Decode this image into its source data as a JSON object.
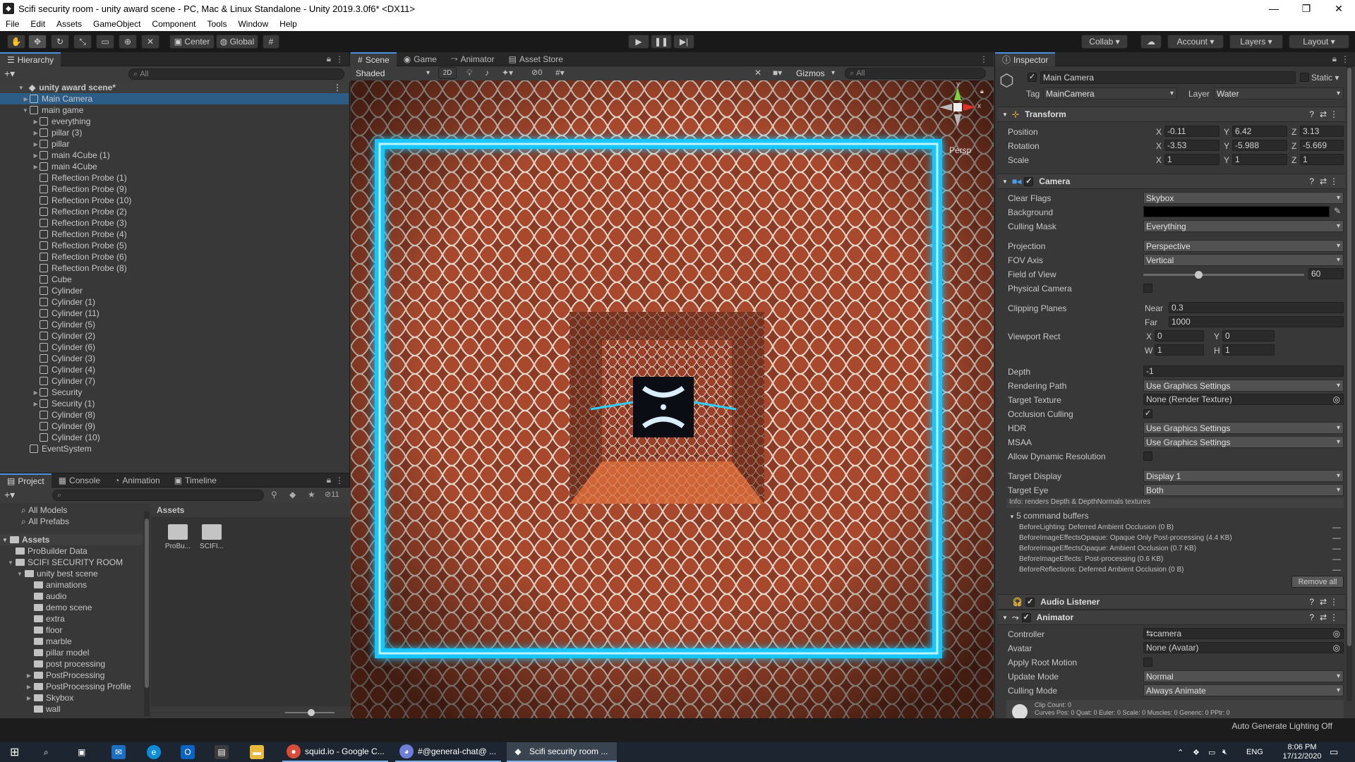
{
  "window": {
    "title": "Scifi security room - unity award scene - PC, Mac & Linux Standalone - Unity 2019.3.0f6* <DX11>",
    "controls": [
      "—",
      "❐",
      "✕"
    ]
  },
  "menu": [
    "File",
    "Edit",
    "Assets",
    "GameObject",
    "Component",
    "Tools",
    "Window",
    "Help"
  ],
  "toolbar": {
    "pivot": "Center",
    "space": "Global",
    "collab": "Collab ▾",
    "account": "Account",
    "layers": "Layers",
    "layout": "Layout"
  },
  "hierarchy": {
    "tab": "Hierarchy",
    "search_placeholder": "All",
    "scene": "unity award scene*",
    "items": [
      {
        "label": "Main Camera",
        "indent": 1,
        "arrow": "▶"
      },
      {
        "label": "main game",
        "indent": 1,
        "arrow": "▼"
      },
      {
        "label": "everything",
        "indent": 2,
        "arrow": "▶"
      },
      {
        "label": "pillar (3)",
        "indent": 2,
        "arrow": "▶"
      },
      {
        "label": "pillar",
        "indent": 2,
        "arrow": "▶"
      },
      {
        "label": "main 4Cube (1)",
        "indent": 2,
        "arrow": "▶"
      },
      {
        "label": "main 4Cube",
        "indent": 2,
        "arrow": "▶"
      },
      {
        "label": "Reflection Probe (1)",
        "indent": 2,
        "arrow": ""
      },
      {
        "label": "Reflection Probe (9)",
        "indent": 2,
        "arrow": ""
      },
      {
        "label": "Reflection Probe (10)",
        "indent": 2,
        "arrow": ""
      },
      {
        "label": "Reflection Probe (2)",
        "indent": 2,
        "arrow": ""
      },
      {
        "label": "Reflection Probe (3)",
        "indent": 2,
        "arrow": ""
      },
      {
        "label": "Reflection Probe (4)",
        "indent": 2,
        "arrow": ""
      },
      {
        "label": "Reflection Probe (5)",
        "indent": 2,
        "arrow": ""
      },
      {
        "label": "Reflection Probe (6)",
        "indent": 2,
        "arrow": ""
      },
      {
        "label": "Reflection Probe (8)",
        "indent": 2,
        "arrow": ""
      },
      {
        "label": "Cube",
        "indent": 2,
        "arrow": ""
      },
      {
        "label": "Cylinder",
        "indent": 2,
        "arrow": ""
      },
      {
        "label": "Cylinder (1)",
        "indent": 2,
        "arrow": ""
      },
      {
        "label": "Cylinder (11)",
        "indent": 2,
        "arrow": ""
      },
      {
        "label": "Cylinder (5)",
        "indent": 2,
        "arrow": ""
      },
      {
        "label": "Cylinder (2)",
        "indent": 2,
        "arrow": ""
      },
      {
        "label": "Cylinder (6)",
        "indent": 2,
        "arrow": ""
      },
      {
        "label": "Cylinder (3)",
        "indent": 2,
        "arrow": ""
      },
      {
        "label": "Cylinder (4)",
        "indent": 2,
        "arrow": ""
      },
      {
        "label": "Cylinder (7)",
        "indent": 2,
        "arrow": ""
      },
      {
        "label": "Security",
        "indent": 2,
        "arrow": "▶"
      },
      {
        "label": "Security (1)",
        "indent": 2,
        "arrow": "▶"
      },
      {
        "label": "Cylinder (8)",
        "indent": 2,
        "arrow": ""
      },
      {
        "label": "Cylinder (9)",
        "indent": 2,
        "arrow": ""
      },
      {
        "label": "Cylinder (10)",
        "indent": 2,
        "arrow": ""
      },
      {
        "label": "EventSystem",
        "indent": 1,
        "arrow": ""
      }
    ]
  },
  "bottom_tabs": [
    "Project",
    "Console",
    "Animation",
    "Timeline"
  ],
  "project": {
    "favorites": [
      "All Models",
      "All Prefabs"
    ],
    "assets_label": "Assets",
    "tree": [
      {
        "label": "ProBuilder Data",
        "indent": 1,
        "arrow": ""
      },
      {
        "label": "SCIFI SECURITY ROOM",
        "indent": 1,
        "arrow": "▼"
      },
      {
        "label": "unity best scene",
        "indent": 2,
        "arrow": "▼"
      },
      {
        "label": "animations",
        "indent": 3,
        "arrow": ""
      },
      {
        "label": "audio",
        "indent": 3,
        "arrow": ""
      },
      {
        "label": "demo scene",
        "indent": 3,
        "arrow": ""
      },
      {
        "label": "extra",
        "indent": 3,
        "arrow": ""
      },
      {
        "label": "floor",
        "indent": 3,
        "arrow": ""
      },
      {
        "label": "marble",
        "indent": 3,
        "arrow": ""
      },
      {
        "label": "pillar model",
        "indent": 3,
        "arrow": ""
      },
      {
        "label": "post processing",
        "indent": 3,
        "arrow": ""
      },
      {
        "label": "PostProcessing",
        "indent": 3,
        "arrow": "▶"
      },
      {
        "label": "PostProcessing Profile",
        "indent": 3,
        "arrow": "▶"
      },
      {
        "label": "Skybox",
        "indent": 3,
        "arrow": "▶"
      },
      {
        "label": "wall",
        "indent": 3,
        "arrow": ""
      }
    ],
    "grid_header": "Assets",
    "grid_items": [
      "ProBu...",
      "SCIFI..."
    ],
    "hidden_count": "11"
  },
  "scene_view": {
    "tabs": [
      "Scene",
      "Game",
      "Animator",
      "Asset Store"
    ],
    "shading": "Shaded",
    "mode_2d": "2D",
    "hidden_count": "0",
    "gizmos": "Gizmos",
    "search_placeholder": "All",
    "persp": "Persp",
    "axis_x": "x",
    "axis_y": "y"
  },
  "inspector": {
    "tab": "Inspector",
    "object_name": "Main Camera",
    "static": "Static",
    "tag_label": "Tag",
    "tag": "MainCamera",
    "layer_label": "Layer",
    "layer": "Water",
    "transform": {
      "title": "Transform",
      "rows": [
        {
          "label": "Position",
          "x": "-0.11",
          "y": "6.42",
          "z": "3.13"
        },
        {
          "label": "Rotation",
          "x": "-3.53",
          "y": "-5.988",
          "z": "-5.669"
        },
        {
          "label": "Scale",
          "x": "1",
          "y": "1",
          "z": "1"
        }
      ]
    },
    "camera": {
      "title": "Camera",
      "clear_flags_label": "Clear Flags",
      "clear_flags": "Skybox",
      "background_label": "Background",
      "culling_mask_label": "Culling Mask",
      "culling_mask": "Everything",
      "projection_label": "Projection",
      "projection": "Perspective",
      "fov_axis_label": "FOV Axis",
      "fov_axis": "Vertical",
      "fov_label": "Field of View",
      "fov": "60",
      "fov_slider_fraction": 0.34,
      "physical_label": "Physical Camera",
      "clipping_label": "Clipping Planes",
      "near_label": "Near",
      "near": "0.3",
      "far_label": "Far",
      "far": "1000",
      "viewport_label": "Viewport Rect",
      "vx": "0",
      "vy": "0",
      "vw": "1",
      "vh": "1",
      "depth_label": "Depth",
      "depth": "-1",
      "rendering_path_label": "Rendering Path",
      "rendering_path": "Use Graphics Settings",
      "target_texture_label": "Target Texture",
      "target_texture": "None (Render Texture)",
      "occlusion_label": "Occlusion Culling",
      "hdr_label": "HDR",
      "hdr": "Use Graphics Settings",
      "msaa_label": "MSAA",
      "msaa": "Use Graphics Settings",
      "dyn_res_label": "Allow Dynamic Resolution",
      "target_display_label": "Target Display",
      "target_display": "Display 1",
      "target_eye_label": "Target Eye",
      "target_eye": "Both",
      "info": "Info: renders Depth & DepthNormals textures",
      "cmd_header": "5 command buffers",
      "cmd_buffers": [
        "BeforeLighting: Deferred Ambient Occlusion (0 B)",
        "BeforeImageEffectsOpaque: Opaque Only Post-processing (4.4 KB)",
        "BeforeImageEffectsOpaque: Ambient Occlusion (0.7 KB)",
        "BeforeImageEffects: Post-processing (0.6 KB)",
        "BeforeReflections: Deferred Ambient Occlusion (0 B)"
      ],
      "remove_all": "Remove all"
    },
    "audio_listener": "Audio Listener",
    "animator": {
      "title": "Animator",
      "controller_label": "Controller",
      "controller": "camera",
      "avatar_label": "Avatar",
      "avatar": "None (Avatar)",
      "root_motion_label": "Apply Root Motion",
      "update_mode_label": "Update Mode",
      "update_mode": "Normal",
      "culling_mode_label": "Culling Mode",
      "culling_mode": "Always Animate",
      "clip_count": "Clip Count: 0",
      "curves": "Curves Pos: 0 Quat: 0 Euler: 0 Scale: 0 Muscles: 0 Generic: 0 PPtr: 0"
    }
  },
  "statusbar": "Auto Generate Lighting Off",
  "taskbar": {
    "apps": [
      "squid.io - Google C...",
      "#@general-chat@ ...",
      "Scifi security room ..."
    ],
    "lang": "ENG",
    "time": "8:06 PM",
    "date": "17/12/2020"
  },
  "colors": {
    "accent": "#4a90e2",
    "selection": "#2c5d87",
    "neon": "#16c6ff"
  }
}
